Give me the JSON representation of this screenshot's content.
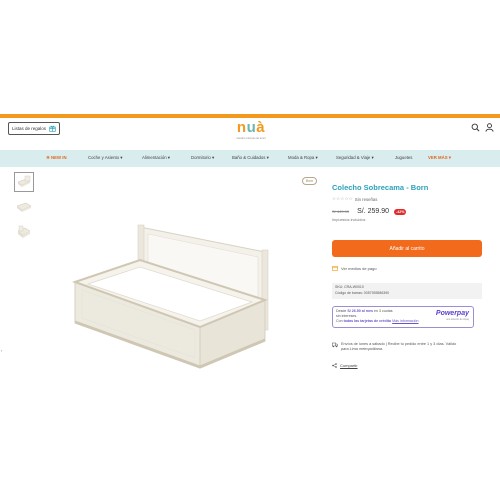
{
  "header": {
    "registry_label": "Listas de regalos",
    "logo": {
      "letters": [
        "n",
        "u",
        "à"
      ],
      "tagline": "nuestro universo de amor"
    },
    "icons": [
      "gift-icon",
      "search-icon",
      "user-icon"
    ]
  },
  "nav": {
    "items": [
      {
        "label": "☀ NEW IN",
        "highlight": true
      },
      {
        "label": "Coche y Asiento ▾",
        "highlight": false
      },
      {
        "label": "Alimentación ▾",
        "highlight": false
      },
      {
        "label": "Dormitorio ▾",
        "highlight": false
      },
      {
        "label": "Baño & Cuidados ▾",
        "highlight": false
      },
      {
        "label": "Moda & Ropa ▾",
        "highlight": false
      },
      {
        "label": "Seguridad & Viaje ▾",
        "highlight": false
      },
      {
        "label": "Juguetes",
        "highlight": false
      },
      {
        "label": "VER MÁS ▾",
        "highlight": true
      }
    ]
  },
  "gallery": {
    "brand_badge": "Born",
    "thumbnails": 3
  },
  "product": {
    "title": "Colecho Sobrecama - Born",
    "reviews": "Sin reseñas",
    "old_price": "S/ 449.90",
    "price": "S/. 259.90",
    "discount": "-42%",
    "tax_note": "Impuestos incluidos",
    "add_to_cart": "Añadir al carrito",
    "payment_methods": "Ver medios de pago",
    "sku_line": "SKU: CRA-W0010",
    "barcode_line": "Código de barras: 0057935586390",
    "powerpay": {
      "line1_pre": "Desde",
      "line1_amount": "S/ 26.50 al mes",
      "line1_post": "en 3 cuotas",
      "line2": "sin intereses.",
      "line3_pre": "Con",
      "line3_bold": "todas las tarjetas de crédito",
      "line3_link": "Más información",
      "logo": "Powerpay",
      "logo_sub": "una solución de izipay"
    },
    "shipping_line1": "Envíos de lunes a sábado | Recibe tu pedido entre 1 y 3 días. Válido",
    "shipping_line2": "para Lima metropolitana.",
    "share": "Compartir"
  },
  "colors": {
    "accent_orange": "#f26a1b",
    "brand_teal": "#2aa3b8",
    "nav_bg": "#d9ecee",
    "discount_red": "#e02b2b",
    "powerpay_purple": "#5b3fc8"
  }
}
